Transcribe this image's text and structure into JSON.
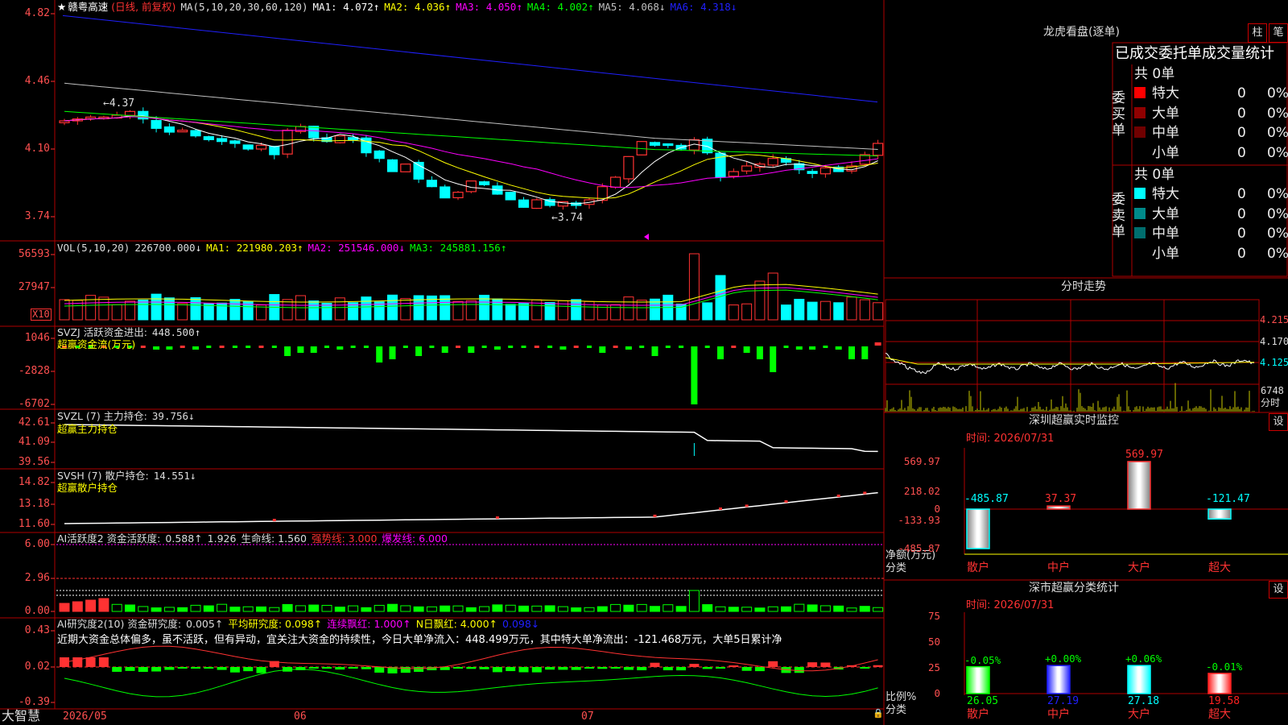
{
  "stock": {
    "name": "赣粤高速",
    "mode": "(日线, 前复权)"
  },
  "colors": {
    "red": "#ff3232",
    "cyan": "#00ffff",
    "yellow": "#ffff00",
    "magenta": "#ff00ff",
    "green": "#00ff00",
    "blue": "#2020ff",
    "white": "#ffffff",
    "grid": "#b00000",
    "label": "#ff5050"
  },
  "kline": {
    "ma_header": "MA(5,10,20,30,60,120)",
    "mas": [
      {
        "label": "MA1: 4.072↑",
        "color": "#ffffff"
      },
      {
        "label": "MA2: 4.036↑",
        "color": "#ffff00"
      },
      {
        "label": "MA3: 4.050↑",
        "color": "#ff00ff"
      },
      {
        "label": "MA4: 4.002↑",
        "color": "#00ff00"
      },
      {
        "label": "MA5: 4.068↓",
        "color": "#c0c0c0"
      },
      {
        "label": "MA6: 4.318↓",
        "color": "#2020ff"
      }
    ],
    "yticks": [
      "4.82",
      "4.46",
      "4.10",
      "3.74"
    ],
    "high_label": "4.37",
    "low_label": "3.74"
  },
  "vol": {
    "header": "VOL(5,10,20)",
    "value": "226700.000↓",
    "ma1": "MA1: 221980.203↑",
    "ma2": "MA2: 251546.000↓",
    "ma3": "MA3: 245881.156↑",
    "yticks": [
      "56593",
      "27947"
    ],
    "unit": "X10"
  },
  "svzj": {
    "header": "SVZJ  活跃资金进出:",
    "value": "448.500↑",
    "sub": "超赢资金流(万元)",
    "yticks": [
      "1046",
      "-2828",
      "-6702"
    ]
  },
  "svzl": {
    "header": "SVZL (7) 主力持仓:",
    "value": "39.756↓",
    "sub": "超赢主力持仓",
    "yticks": [
      "42.61",
      "41.09",
      "39.56"
    ]
  },
  "svsh": {
    "header": "SVSH (7) 散户持仓:",
    "value": "14.551↓",
    "sub": "超赢散户持仓",
    "yticks": [
      "14.82",
      "13.18",
      "11.60"
    ]
  },
  "ai1": {
    "header": "AI活跃度2 资金活跃度:",
    "v1": "0.588↑",
    "v2": "1.926",
    "life": "生命线: 1.560",
    "strong": "强势线: 3.000",
    "burst": "爆发线: 6.000",
    "yticks": [
      "6.00",
      "2.96",
      "0.00"
    ]
  },
  "ai2": {
    "header": "AI研究度2(10) 资金研究度:",
    "v1": "0.005↑",
    "avg": "平均研究度: 0.098↑",
    "cont": "连续飘红: 1.000↑",
    "nday": "N日飘红: 4.000↑",
    "v5": "0.098↓",
    "note": "近期大资金总体偏多，虽不活跃，但有异动，宜关注大资金的持续性，今日大单净流入：448.499万元，其中特大单净流出：-121.468万元，大单5日累计净",
    "yticks": [
      "0.43",
      "0.02",
      "-0.39"
    ]
  },
  "dates": [
    "2026/05",
    "06",
    "07"
  ],
  "brand": "大智慧",
  "lhb": {
    "title": "龙虎看盘(逐单)",
    "btn1": "柱",
    "btn2": "笔",
    "subtitle": "已成交委托单成交量统计",
    "buy_label": "委买单",
    "buy_total": "共 0单",
    "buy_rows": [
      {
        "name": "特大",
        "v": "0",
        "p": "0%",
        "c": "#ff0000"
      },
      {
        "name": "大单",
        "v": "0",
        "p": "0%",
        "c": "#900000"
      },
      {
        "name": "中单",
        "v": "0",
        "p": "0%",
        "c": "#700000"
      },
      {
        "name": "小单",
        "v": "0",
        "p": "0%",
        "c": ""
      }
    ],
    "sell_label": "委卖单",
    "sell_total": "共 0单",
    "sell_rows": [
      {
        "name": "特大",
        "v": "0",
        "p": "0%",
        "c": "#00ffff"
      },
      {
        "name": "大单",
        "v": "0",
        "p": "0%",
        "c": "#008a8a"
      },
      {
        "name": "中单",
        "v": "0",
        "p": "0%",
        "c": "#006e6e"
      },
      {
        "name": "小单",
        "v": "0",
        "p": "0%",
        "c": ""
      }
    ]
  },
  "fenshi": {
    "title": "分时走势",
    "yticks": [
      "4.215",
      "4.170",
      "4.125"
    ],
    "vol_label": "6748",
    "vol_unit": "分时"
  },
  "monitor": {
    "title": "深圳超赢实时监控",
    "btn": "设",
    "time": "时间: 2026/07/31",
    "yticks": [
      "569.97",
      "218.02",
      "0",
      "-133.93",
      "-485.87"
    ],
    "ylabel": "净额(万元)",
    "xlabel": "分类",
    "bars": [
      {
        "cat": "散户",
        "value": -485.87,
        "label": "-485.87",
        "cat_color": "#ff3232"
      },
      {
        "cat": "中户",
        "value": 37.37,
        "label": "37.37",
        "cat_color": "#ff3232"
      },
      {
        "cat": "大户",
        "value": 569.97,
        "label": "569.97",
        "cat_color": "#ff3232"
      },
      {
        "cat": "超大",
        "value": -121.47,
        "label": "-121.47",
        "cat_color": "#ff3232"
      }
    ]
  },
  "classstat": {
    "title": "深市超赢分类统计",
    "btn": "设",
    "time": "时间: 2026/07/31",
    "yticks": [
      "75",
      "50",
      "25",
      "0"
    ],
    "ylabel": "比例%",
    "xlabel": "分类",
    "bars": [
      {
        "cat": "散户",
        "value": 26.05,
        "label": "26.05",
        "delta": "-0.05%",
        "color": "#00ff00"
      },
      {
        "cat": "中户",
        "value": 27.19,
        "label": "27.19",
        "delta": "+0.00%",
        "color": "#2020ff"
      },
      {
        "cat": "大户",
        "value": 27.18,
        "label": "27.18",
        "delta": "+0.06%",
        "color": "#00ffff"
      },
      {
        "cat": "超大",
        "value": 19.58,
        "label": "19.58",
        "delta": "-0.01%",
        "color": "#ff2020"
      }
    ]
  }
}
